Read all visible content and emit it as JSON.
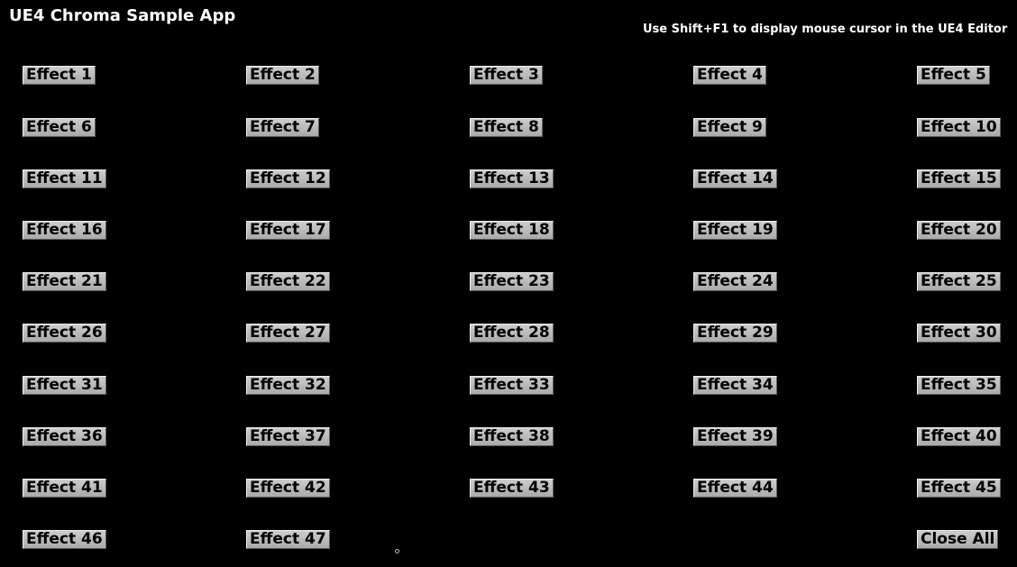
{
  "app": {
    "title": "UE4 Chroma Sample App",
    "hint": "Use Shift+F1 to display mouse cursor in the UE4 Editor"
  },
  "buttons": [
    "Effect 1",
    "Effect 2",
    "Effect 3",
    "Effect 4",
    "Effect 5",
    "Effect 6",
    "Effect 7",
    "Effect 8",
    "Effect 9",
    "Effect 10",
    "Effect 11",
    "Effect 12",
    "Effect 13",
    "Effect 14",
    "Effect 15",
    "Effect 16",
    "Effect 17",
    "Effect 18",
    "Effect 19",
    "Effect 20",
    "Effect 21",
    "Effect 22",
    "Effect 23",
    "Effect 24",
    "Effect 25",
    "Effect 26",
    "Effect 27",
    "Effect 28",
    "Effect 29",
    "Effect 30",
    "Effect 31",
    "Effect 32",
    "Effect 33",
    "Effect 34",
    "Effect 35",
    "Effect 36",
    "Effect 37",
    "Effect 38",
    "Effect 39",
    "Effect 40",
    "Effect 41",
    "Effect 42",
    "Effect 43",
    "Effect 44",
    "Effect 45",
    "Effect 46",
    "Effect 47",
    "Close All"
  ]
}
